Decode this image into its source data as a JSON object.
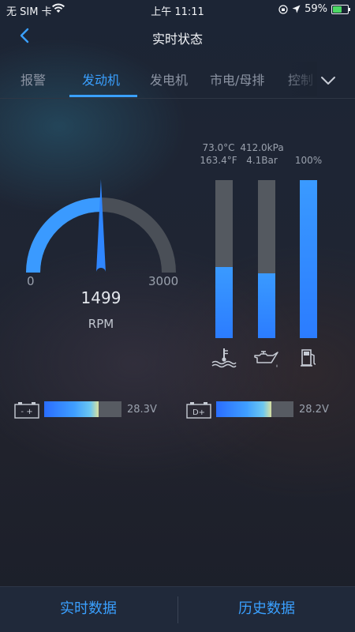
{
  "status_bar": {
    "carrier": "无 SIM 卡",
    "time": "上午 11:11",
    "battery": "59%"
  },
  "nav": {
    "title": "实时状态",
    "back_icon": "chevron-left-icon"
  },
  "tabs": [
    {
      "label": "报警",
      "active": false
    },
    {
      "label": "发动机",
      "active": true
    },
    {
      "label": "发电机",
      "active": false
    },
    {
      "label": "市电/母排",
      "active": false
    },
    {
      "label": "控制",
      "active": false
    }
  ],
  "gauge": {
    "min_label": "0",
    "max_label": "3000",
    "min": 0,
    "max": 3000,
    "value": 1499,
    "value_text": "1499",
    "unit": "RPM",
    "arc_color": "#3a9aff",
    "track_color": "#4a4f57"
  },
  "vertical_meters": [
    {
      "name": "coolant",
      "line1": "73.0°C",
      "line2": "163.4°F",
      "fill_fraction": 0.45,
      "icon": "coolant-temperature-icon"
    },
    {
      "name": "oil-pressure",
      "line1": "412.0kPa",
      "line2": "4.1Bar",
      "fill_fraction": 0.41,
      "icon": "oil-can-icon"
    },
    {
      "name": "fuel",
      "line1": "100%",
      "line2": "",
      "fill_fraction": 1.0,
      "icon": "fuel-pump-icon"
    }
  ],
  "horizontal_meters": [
    {
      "name": "battery-voltage",
      "icon_text": "- +",
      "value_text": "28.3V",
      "fill_fraction": 0.7,
      "icon": "battery-icon"
    },
    {
      "name": "charger-voltage",
      "icon_text": "D+",
      "value_text": "28.2V",
      "fill_fraction": 0.71,
      "icon": "d-plus-icon"
    }
  ],
  "bottom": {
    "left_label": "实时数据",
    "right_label": "历史数据"
  },
  "colors": {
    "accent": "#3aa0ff",
    "inactive_tab": "#8c94a3"
  }
}
